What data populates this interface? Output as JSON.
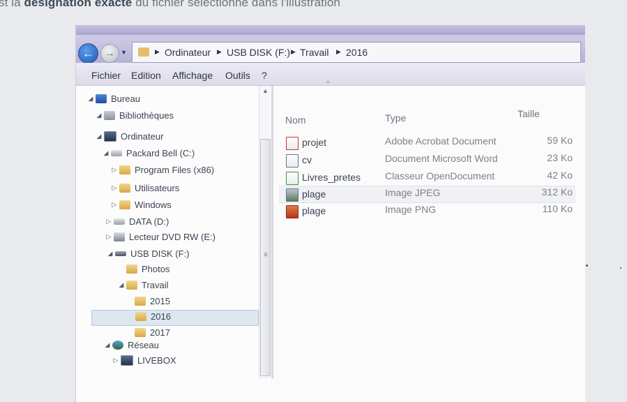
{
  "question": {
    "prefix": "st la",
    "bold": "désignation exacte",
    "suffix": "du fichier sélectionné dans l'illustration"
  },
  "address": {
    "segments": [
      "Ordinateur",
      "USB DISK (F:)",
      "Travail",
      "2016"
    ]
  },
  "menu": [
    "Fichier",
    "Edition",
    "Affichage",
    "Outils",
    "?"
  ],
  "tree": [
    {
      "label": "Bureau",
      "icon": "desktop-icon",
      "arrow": "expanded"
    },
    {
      "label": "Bibliothèques",
      "icon": "library-icon",
      "arrow": "expanded"
    },
    {
      "label": "Ordinateur",
      "icon": "computer-icon",
      "arrow": "expanded"
    },
    {
      "label": "Packard Bell (C:)",
      "icon": "drive-icon",
      "arrow": "expanded"
    },
    {
      "label": "Program Files (x86)",
      "icon": "folder-icon",
      "arrow": "collapsed"
    },
    {
      "label": "Utilisateurs",
      "icon": "folder-icon",
      "arrow": "collapsed"
    },
    {
      "label": "Windows",
      "icon": "folder-icon",
      "arrow": "collapsed"
    },
    {
      "label": "DATA (D:)",
      "icon": "drive-icon",
      "arrow": "collapsed"
    },
    {
      "label": "Lecteur DVD RW (E:)",
      "icon": "dvd-icon",
      "arrow": "collapsed"
    },
    {
      "label": "USB DISK (F:)",
      "icon": "usb-icon",
      "arrow": "expanded"
    },
    {
      "label": "Photos",
      "icon": "folder-icon",
      "arrow": "none"
    },
    {
      "label": "Travail",
      "icon": "folder-icon",
      "arrow": "expanded"
    },
    {
      "label": "2015",
      "icon": "folder-icon",
      "arrow": "none"
    },
    {
      "label": "2016",
      "icon": "folder-icon",
      "arrow": "none",
      "selected": true
    },
    {
      "label": "2017",
      "icon": "folder-icon",
      "arrow": "none"
    },
    {
      "label": "Réseau",
      "icon": "network-icon",
      "arrow": "expanded"
    },
    {
      "label": "LIVEBOX",
      "icon": "computer-icon",
      "arrow": "collapsed"
    }
  ],
  "columns": {
    "name": "Nom",
    "type": "Type",
    "size": "Taille"
  },
  "files": [
    {
      "name": "projet",
      "type": "Adobe Acrobat Document",
      "size": "59 Ko",
      "icon": "pdf-icon"
    },
    {
      "name": "cv",
      "type": "Document Microsoft Word",
      "size": "23 Ko",
      "icon": "word-icon"
    },
    {
      "name": "Livres_pretes",
      "type": "Classeur OpenDocument",
      "size": "42 Ko",
      "icon": "spreadsheet-icon"
    },
    {
      "name": "plage",
      "type": "Image JPEG",
      "size": "312 Ko",
      "icon": "jpeg-icon",
      "selected": true
    },
    {
      "name": "plage",
      "type": "Image PNG",
      "size": "110 Ko",
      "icon": "png-icon"
    }
  ]
}
